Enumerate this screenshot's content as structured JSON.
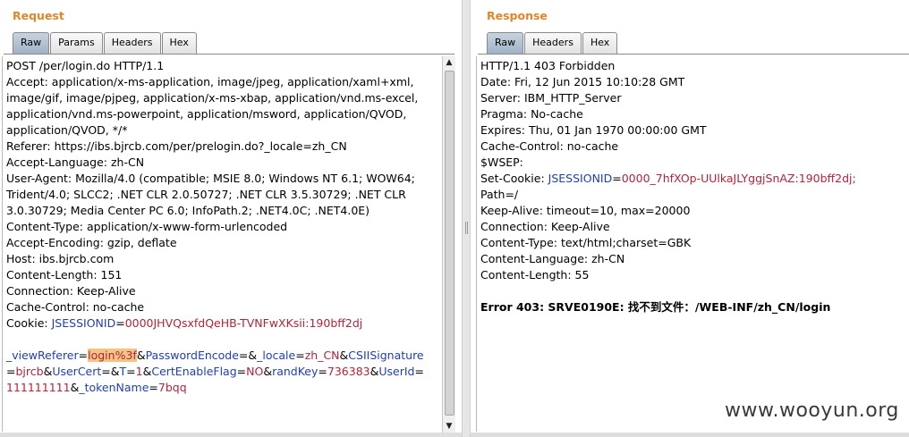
{
  "request": {
    "title": "Request",
    "tabs": [
      "Raw",
      "Params",
      "Headers",
      "Hex"
    ],
    "lines": [
      "POST /per/login.do HTTP/1.1",
      "Accept: application/x-ms-application, image/jpeg, application/xaml+xml,",
      "image/gif, image/pjpeg, application/x-ms-xbap, application/vnd.ms-excel,",
      "application/vnd.ms-powerpoint, application/msword, application/QVOD,",
      "application/QVOD, */*",
      "Referer: https://ibs.bjrcb.com/per/prelogin.do?_locale=zh_CN",
      "Accept-Language: zh-CN",
      "User-Agent: Mozilla/4.0 (compatible; MSIE 8.0; Windows NT 6.1; WOW64;",
      "Trident/4.0; SLCC2; .NET CLR 2.0.50727; .NET CLR 3.5.30729; .NET CLR",
      "3.0.30729; Media Center PC 6.0; InfoPath.2; .NET4.0C; .NET4.0E)",
      "Content-Type: application/x-www-form-urlencoded",
      "Accept-Encoding: gzip, deflate",
      "Host: ibs.bjrcb.com",
      "Content-Length: 151",
      "Connection: Keep-Alive",
      "Cache-Control: no-cache"
    ],
    "cookie_prefix": "Cookie: ",
    "cookie_key": "JSESSIONID",
    "cookie_eq": "=",
    "cookie_value": "0000JHVQsxfdQeHB-TVNFwXKsii:190bff2dj",
    "body": {
      "l1_k1": "_viewReferer",
      "l1_eq1": "=",
      "l1_v1": "login%3f",
      "l1_amp1": "&",
      "l1_k2": "PasswordEncode",
      "l1_eq2": "=",
      "l1_amp2": "&",
      "l1_k3": "_locale",
      "l1_eq3": "=",
      "l1_v3": "zh_CN",
      "l1_amp3": "&",
      "l1_k4": "CSIISignature",
      "l2_eq4": "=",
      "l2_v4": "bjrcb",
      "l2_amp4": "&",
      "l2_k5": "UserCert",
      "l2_eq5": "=",
      "l2_amp5": "&",
      "l2_k6": "T",
      "l2_eq6": "=",
      "l2_v6": "1",
      "l2_amp6": "&",
      "l2_k7": "CertEnableFlag",
      "l2_eq7": "=",
      "l2_v7": "NO",
      "l2_amp7": "&",
      "l2_k8": "randKey",
      "l2_eq8": "=",
      "l2_v8": "736383",
      "l2_amp8": "&",
      "l2_k9": "UserId",
      "l2_eq9": "=",
      "l3_v9": "111111111",
      "l3_amp9": "&",
      "l3_k10": "_tokenName",
      "l3_eq10": "=",
      "l3_v10": "7bqq"
    }
  },
  "response": {
    "title": "Response",
    "tabs": [
      "Raw",
      "Headers",
      "Hex"
    ],
    "lines_top": [
      "HTTP/1.1 403 Forbidden",
      "Date: Fri, 12 Jun 2015 10:10:28 GMT",
      "Server: IBM_HTTP_Server",
      "Pragma: No-cache",
      "Expires: Thu, 01 Jan 1970 00:00:00 GMT",
      "Cache-Control: no-cache",
      "$WSEP:"
    ],
    "setcookie_prefix": "Set-Cookie: ",
    "setcookie_key": "JSESSIONID",
    "setcookie_eq": "=",
    "setcookie_value": "0000_7hfXOp-UUlkaJLYggjSnAZ:190bff2dj;",
    "lines_bottom": [
      "Path=/",
      "Keep-Alive: timeout=10, max=20000",
      "Connection: Keep-Alive",
      "Content-Type: text/html;charset=GBK",
      "Content-Language: zh-CN",
      "Content-Length: 55"
    ],
    "error": "Error 403: SRVE0190E: 找不到文件：/WEB-INF/zh_CN/login"
  },
  "watermark": "www.wooyun.org",
  "colors": {
    "title": "#e0852a",
    "key": "#1f3fb0",
    "value": "#b0243a",
    "highlight": "#f3c484",
    "active_tab": "#9fb2c6"
  },
  "icons": {
    "scroll_up": "▲",
    "scroll_down": "▼"
  }
}
